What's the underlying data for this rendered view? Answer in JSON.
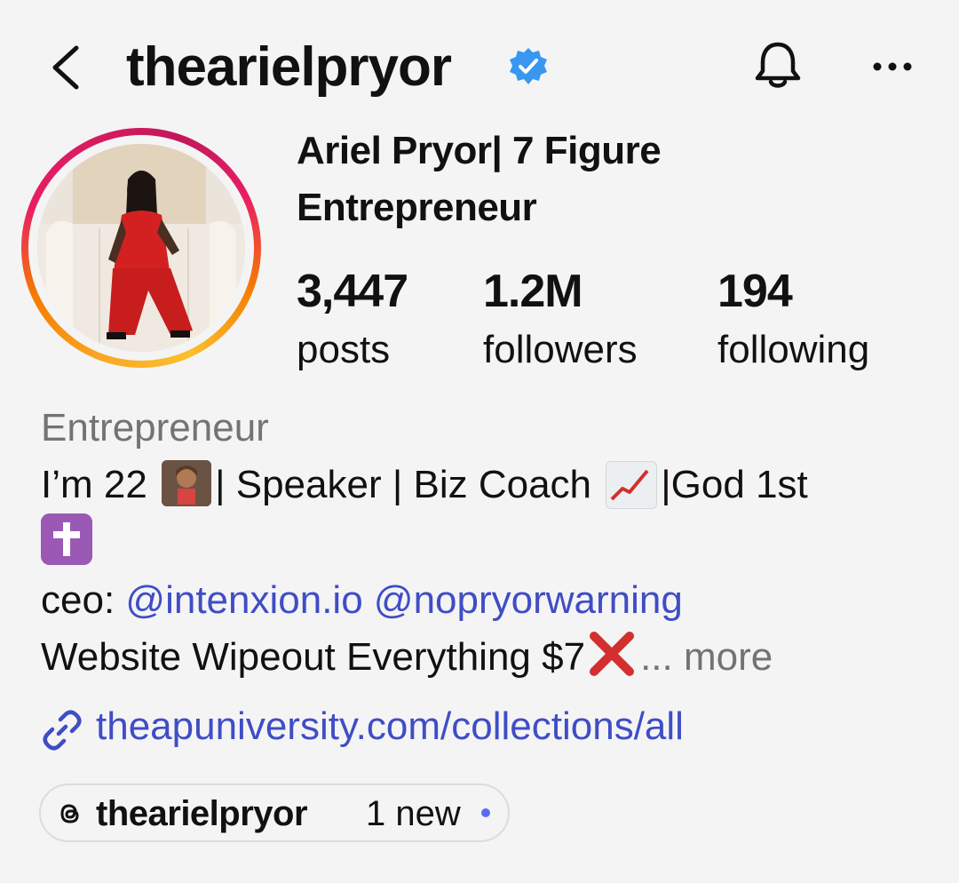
{
  "header": {
    "username": "thearielpryor",
    "back_icon": "chevron-left-icon",
    "verified_icon": "verified-badge-icon",
    "bell_icon": "bell-icon",
    "more_icon": "more-horizontal-icon"
  },
  "profile": {
    "display_name": "Ariel Pryor| 7 Figure Entrepreneur",
    "stats": {
      "posts_count": "3,447",
      "posts_label": "posts",
      "followers_count": "1.2M",
      "followers_label": "followers",
      "following_count": "194",
      "following_label": "following"
    }
  },
  "bio": {
    "category": "Entrepreneur",
    "line1_a": "I’m 22",
    "line1_b": "| Speaker | Biz Coach",
    "line1_c": "|God 1st",
    "line3_prefix": "ceo:",
    "mention1": "@intenxion.io",
    "mention2": "@nopryorwarning",
    "line4_text": "Website Wipeout Everything $7",
    "more_label": "... more"
  },
  "link": {
    "url": "theapuniversity.com/collections/all",
    "icon": "link-icon"
  },
  "threads": {
    "icon": "threads-icon",
    "name": "thearielpryor",
    "badge": "1 new"
  },
  "colors": {
    "background": "#f4f4f5",
    "link": "#3f4dc5",
    "verified": "#3897f0",
    "secondary_text": "#737373"
  }
}
